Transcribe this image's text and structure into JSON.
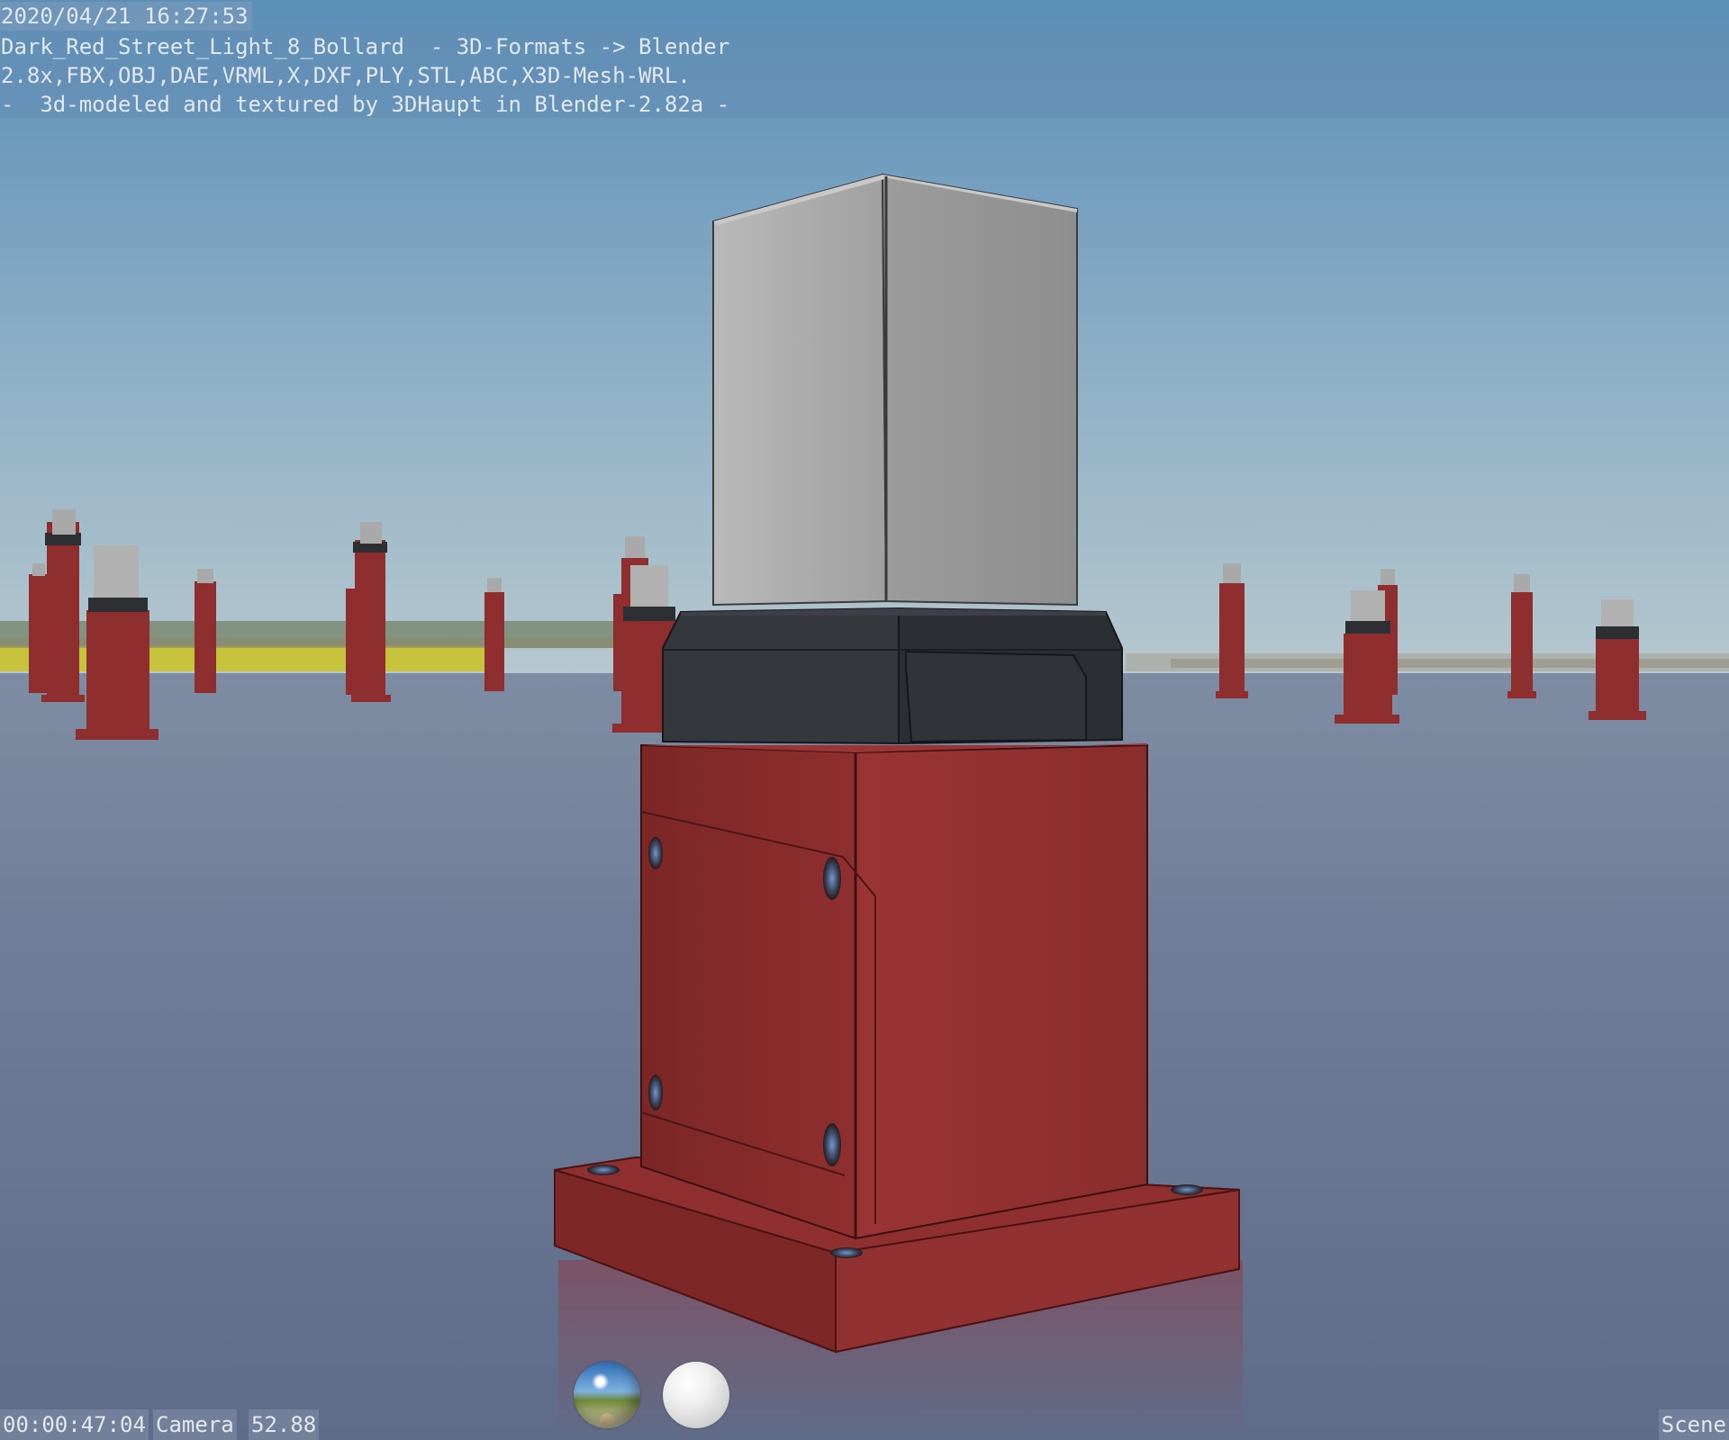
{
  "overlay": {
    "timestamp": "2020/04/21 16:27:53",
    "info_line_1": "Dark_Red_Street_Light_8_Bollard  - 3D-Formats -> Blender",
    "info_line_2": "2.8x,FBX,OBJ,DAE,VRML,X,DXF,PLY,STL,ABC,X3D-Mesh-WRL.",
    "info_line_3": "-  3d-modeled and textured by 3DHaupt in Blender-2.82a -"
  },
  "status": {
    "time": "00:00:47:04",
    "camera": "Camera",
    "lens": "52.88",
    "scene": "Scene"
  },
  "icons": {
    "hdri_preview": "hdri-sphere-icon",
    "matcap_preview": "matcap-sphere-icon"
  },
  "colors": {
    "bollard_red": "#8e2e2e",
    "lamp_cap_dark": "#2f3236",
    "lamp_glass": "#a7a9ab",
    "sky_top": "#5b8fb8",
    "ground": "#6d7a94"
  }
}
